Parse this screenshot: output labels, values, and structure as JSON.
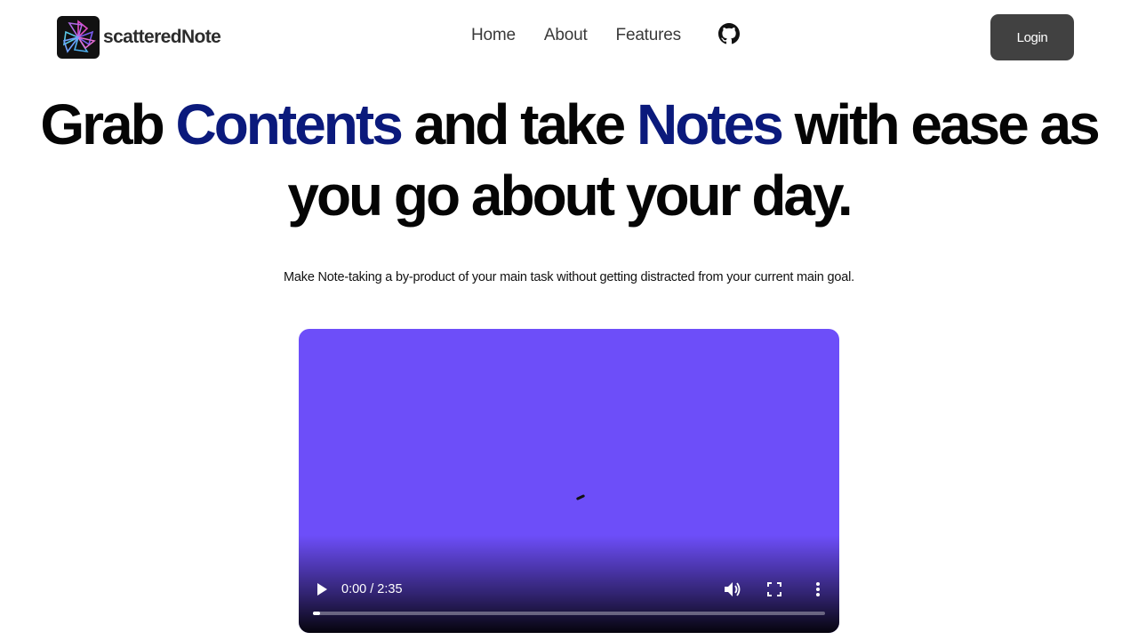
{
  "header": {
    "brand": "scatteredNote",
    "logo_icon": "pinwheel-logo-icon",
    "nav": [
      {
        "label": "Home"
      },
      {
        "label": "About"
      },
      {
        "label": "Features"
      }
    ],
    "github_icon": "github-icon",
    "login_label": "Login"
  },
  "hero": {
    "part1": "Grab ",
    "accent1": "Contents",
    "part2": " and take ",
    "accent2": "Notes",
    "part3": " with ease as you go about your day.",
    "accent_color": "#0b1a7c"
  },
  "subtitle": "Make Note-taking a by-product of your main task without getting distracted from your current main goal.",
  "video": {
    "background_color": "#6d4ef9",
    "time": "0:00 / 2:35",
    "progress": 0,
    "icons": [
      "play-icon",
      "volume-icon",
      "fullscreen-icon",
      "more-options-icon"
    ]
  }
}
